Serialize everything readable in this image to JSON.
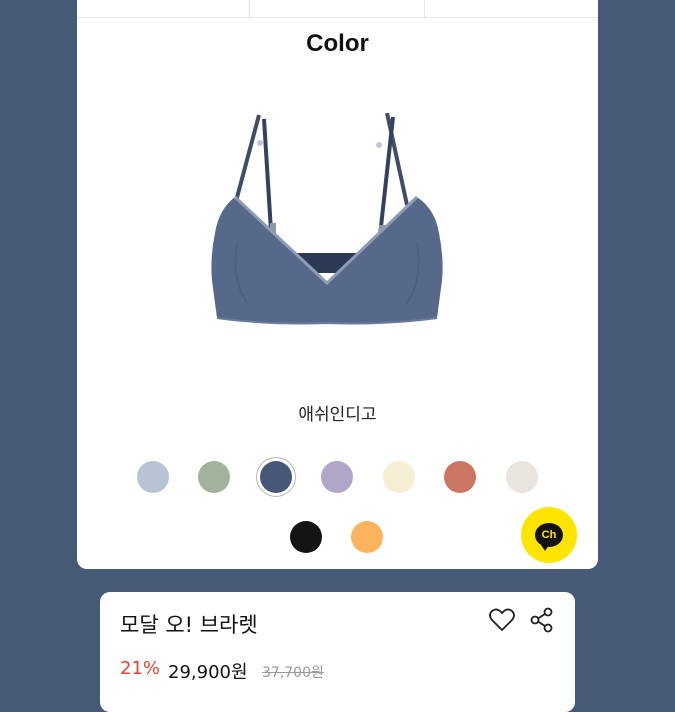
{
  "section": {
    "title": "Color"
  },
  "product": {
    "selected_color_name": "애쉬인디고"
  },
  "swatches": [
    {
      "name": "swatch-light-blue",
      "color": "#b6c4d6"
    },
    {
      "name": "swatch-sage",
      "color": "#a3b39b"
    },
    {
      "name": "swatch-ash-indigo",
      "color": "#475777",
      "selected": true
    },
    {
      "name": "swatch-lavender",
      "color": "#b1a6c8"
    },
    {
      "name": "swatch-cream",
      "color": "#f6eed2"
    },
    {
      "name": "swatch-terracotta",
      "color": "#cb7662"
    },
    {
      "name": "swatch-ivory",
      "color": "#e8e4de"
    },
    {
      "name": "swatch-black",
      "color": "#141414"
    },
    {
      "name": "swatch-orange",
      "color": "#fdb45e"
    }
  ],
  "chat": {
    "label": "Ch"
  },
  "info": {
    "name": "모달 오! 브라렛",
    "discount": "21%",
    "price": "29,900원",
    "original_price": "37,700원"
  },
  "colors": {
    "background": "#465a76",
    "accent_red": "#e2442f",
    "chat_yellow": "#fee500"
  }
}
